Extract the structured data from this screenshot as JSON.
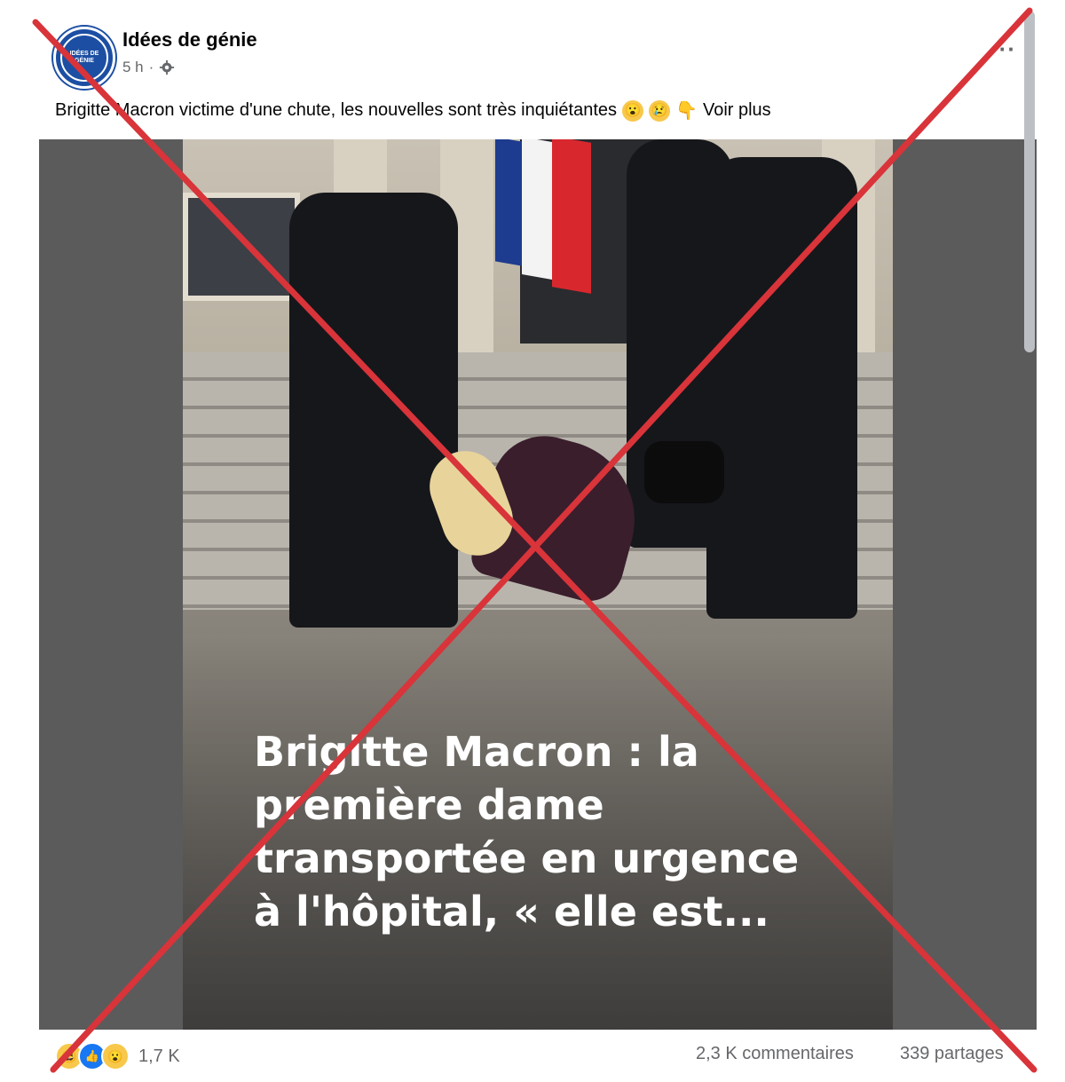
{
  "post": {
    "page_name": "Idées de génie",
    "avatar_text": "IDÉES DE GÉNIE",
    "time": "5 h",
    "separator": "·",
    "more_label": "···",
    "caption": "Brigitte Macron victime d'une chute, les nouvelles sont très inquiétantes",
    "caption_emojis": [
      "😮",
      "😢",
      "👇"
    ],
    "see_more": "Voir plus"
  },
  "media": {
    "headline_lines": [
      "Brigitte Macron : la",
      "première dame",
      "transportée en urgence",
      "à l'hôpital, « elle est..."
    ]
  },
  "footer": {
    "reaction_icons": [
      "haha-icon",
      "like-icon",
      "wow-icon"
    ],
    "reaction_count": "1,7 K",
    "comments": "2,3 K commentaires",
    "shares": "339 partages"
  },
  "colors": {
    "cross": "#d8343a",
    "secondary_text": "#65676b",
    "like_blue": "#1877f2",
    "media_bg": "#5b5b5b"
  }
}
